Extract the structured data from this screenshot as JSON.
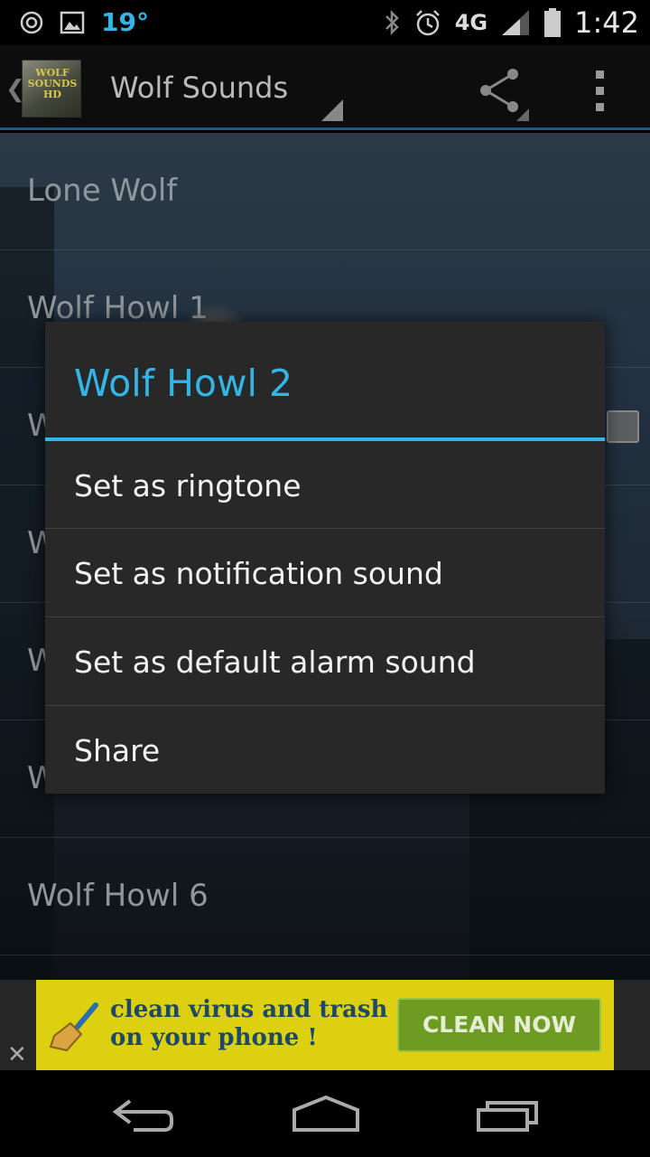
{
  "status_bar": {
    "temperature": "19°",
    "network": "4G",
    "time": "1:42"
  },
  "action_bar": {
    "logo_text": "WOLF SOUNDS HD",
    "title": "Wolf Sounds"
  },
  "list": {
    "items": [
      {
        "label": "Lone Wolf"
      },
      {
        "label": "Wolf Howl 1"
      },
      {
        "label": "W"
      },
      {
        "label": "W"
      },
      {
        "label": "W"
      },
      {
        "label": "W"
      },
      {
        "label": "Wolf Howl 6"
      }
    ]
  },
  "dialog": {
    "title": "Wolf Howl 2",
    "options": [
      {
        "label": "Set as ringtone"
      },
      {
        "label": "Set as notification sound"
      },
      {
        "label": "Set as default alarm sound"
      },
      {
        "label": "Share"
      }
    ]
  },
  "ad": {
    "line1": "clean virus and trash",
    "line2": "on your phone !",
    "button": "CLEAN NOW",
    "close": "✕"
  }
}
